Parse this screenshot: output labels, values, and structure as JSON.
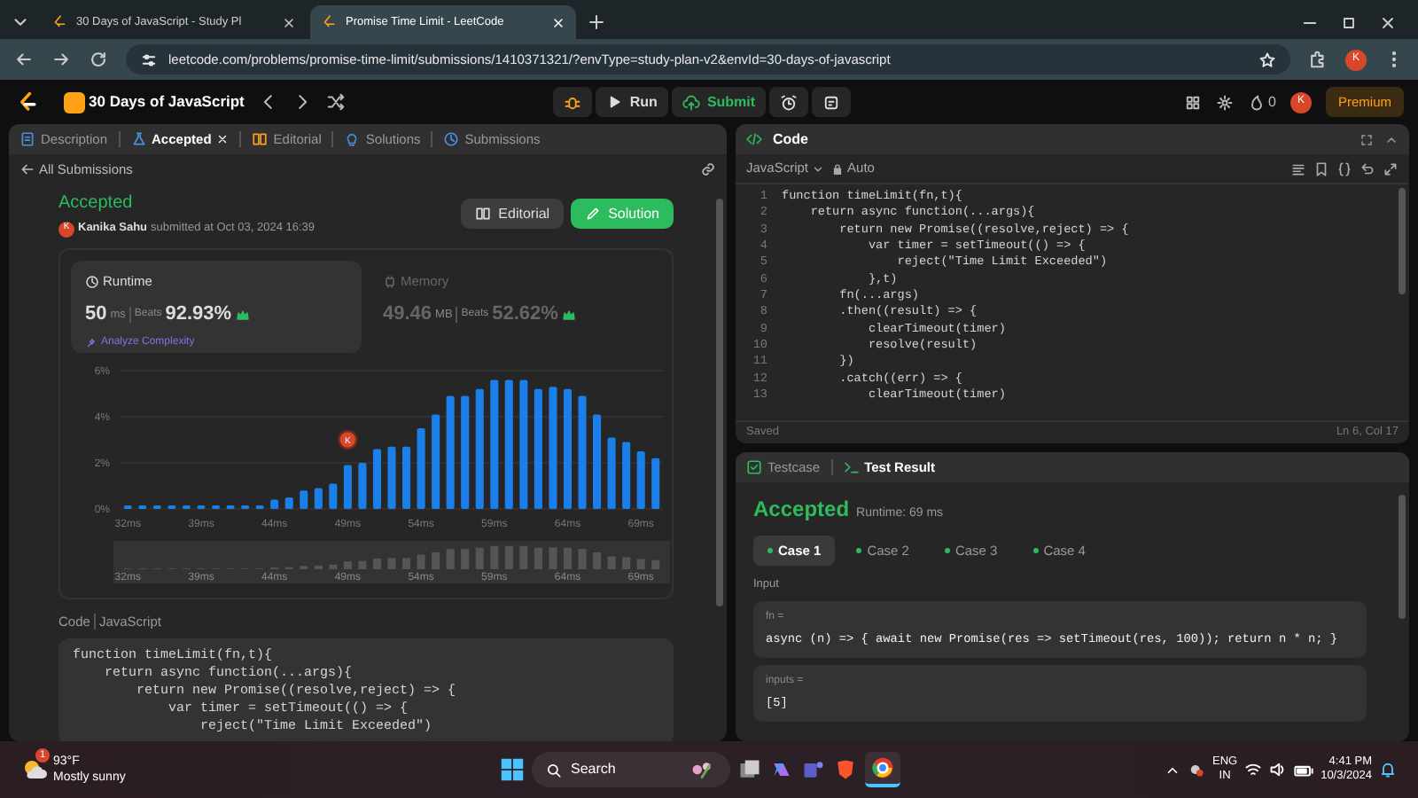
{
  "browser": {
    "tabs": [
      {
        "title": "30 Days of JavaScript - Study Pl",
        "selected": false
      },
      {
        "title": "Promise Time Limit - LeetCode",
        "selected": true
      }
    ],
    "url": "leetcode.com/problems/promise-time-limit/submissions/1410371321/?envType=study-plan-v2&envId=30-days-of-javascript",
    "profile": "K"
  },
  "nav": {
    "title": "30 Days of JavaScript",
    "run": "Run",
    "submit": "Submit",
    "streak": "0",
    "avatar": "K",
    "premium": "Premium"
  },
  "left": {
    "tabs": [
      {
        "label": "Description",
        "selected": false,
        "closable": false
      },
      {
        "label": "Accepted",
        "selected": true,
        "closable": true
      },
      {
        "label": "Editorial",
        "selected": false,
        "closable": false
      },
      {
        "label": "Solutions",
        "selected": false,
        "closable": false
      },
      {
        "label": "Submissions",
        "selected": false,
        "closable": false
      }
    ],
    "back": "All Submissions",
    "status": "Accepted",
    "author_avatar": "K",
    "author": "Kanika Sahu",
    "submitted": "submitted at Oct 03, 2024 16:39",
    "editorial": "Editorial",
    "solution": "Solution",
    "stats": [
      {
        "label": "Runtime",
        "value": "50",
        "unit": "ms",
        "beats_label": "Beats",
        "beats": "92.93%",
        "extra": "Analyze Complexity",
        "selected": true
      },
      {
        "label": "Memory",
        "value": "49.46",
        "unit": "MB",
        "beats_label": "Beats",
        "beats": "52.62%",
        "selected": false
      }
    ],
    "chart_data": {
      "type": "bar",
      "categories": [
        "32ms",
        null,
        null,
        null,
        null,
        "39ms",
        null,
        null,
        null,
        null,
        "44ms",
        null,
        null,
        null,
        null,
        "49ms",
        null,
        null,
        null,
        null,
        "54ms",
        null,
        null,
        null,
        null,
        "59ms",
        null,
        null,
        null,
        null,
        "64ms",
        null,
        null,
        null,
        null,
        "69ms",
        null
      ],
      "values": [
        0.15,
        0.15,
        0.15,
        0.15,
        0.15,
        0.15,
        0.15,
        0.15,
        0.15,
        0.15,
        0.4,
        0.5,
        0.8,
        0.9,
        1.1,
        1.9,
        2.0,
        2.6,
        2.7,
        2.7,
        3.5,
        4.1,
        4.9,
        4.9,
        5.2,
        5.6,
        5.6,
        5.6,
        5.2,
        5.3,
        5.2,
        4.9,
        4.1,
        3.1,
        2.9,
        2.5,
        2.2
      ],
      "ylim": [
        0,
        6
      ],
      "yticks": [
        {
          "value": 0,
          "label": "0%"
        },
        {
          "value": 2,
          "label": "2%"
        },
        {
          "value": 4,
          "label": "4%"
        },
        {
          "value": 6,
          "label": "6%"
        }
      ],
      "annotations": [
        {
          "x": "49ms",
          "y": 3.0,
          "text": "K"
        }
      ]
    },
    "range_labels": [
      "32ms",
      "39ms",
      "44ms",
      "49ms",
      "54ms",
      "59ms",
      "64ms",
      "69ms"
    ],
    "code_label": "Code",
    "code_lang": "JavaScript",
    "code": [
      "function timeLimit(fn,t){",
      "    return async function(...args){",
      "        return new Promise((resolve,reject) => {",
      "            var timer = setTimeout(() => {",
      "                reject(\"Time Limit Exceeded\")"
    ]
  },
  "editor": {
    "title": "Code",
    "language": "JavaScript",
    "mode": "Auto",
    "lines": [
      {
        "no": "1",
        "text": "function timeLimit(fn,t){"
      },
      {
        "no": "2",
        "text": "    return async function(...args){"
      },
      {
        "no": "3",
        "text": "        return new Promise((resolve,reject) => {"
      },
      {
        "no": "4",
        "text": "            var timer = setTimeout(() => {"
      },
      {
        "no": "5",
        "text": "                reject(\"Time Limit Exceeded\")"
      },
      {
        "no": "6",
        "text": "            },t)"
      },
      {
        "no": "7",
        "text": "        fn(...args)"
      },
      {
        "no": "8",
        "text": "        .then((result) => {"
      },
      {
        "no": "9",
        "text": "            clearTimeout(timer)"
      },
      {
        "no": "10",
        "text": "            resolve(result)"
      },
      {
        "no": "11",
        "text": "        })"
      },
      {
        "no": "12",
        "text": "        .catch((err) => {"
      },
      {
        "no": "13",
        "text": "            clearTimeout(timer)"
      }
    ],
    "saved": "Saved",
    "position": "Ln 6, Col 17"
  },
  "test": {
    "tabs": [
      {
        "label": "Testcase",
        "selected": false
      },
      {
        "label": "Test Result",
        "selected": true
      }
    ],
    "status": "Accepted",
    "runtime": "Runtime: 69 ms",
    "cases": [
      {
        "label": "Case 1",
        "selected": true
      },
      {
        "label": "Case 2",
        "selected": false
      },
      {
        "label": "Case 3",
        "selected": false
      },
      {
        "label": "Case 4",
        "selected": false
      }
    ],
    "input_label": "Input",
    "params": [
      {
        "name": "fn =",
        "value": "async (n) => { await new Promise(res => setTimeout(res, 100)); return n * n; }"
      },
      {
        "name": "inputs =",
        "value": "[5]"
      }
    ]
  },
  "taskbar": {
    "badge": "1",
    "temp": "93°F",
    "weather": "Mostly sunny",
    "search": "Search",
    "lang": "ENG",
    "region": "IN",
    "time": "4:41 PM",
    "date": "10/3/2024"
  }
}
